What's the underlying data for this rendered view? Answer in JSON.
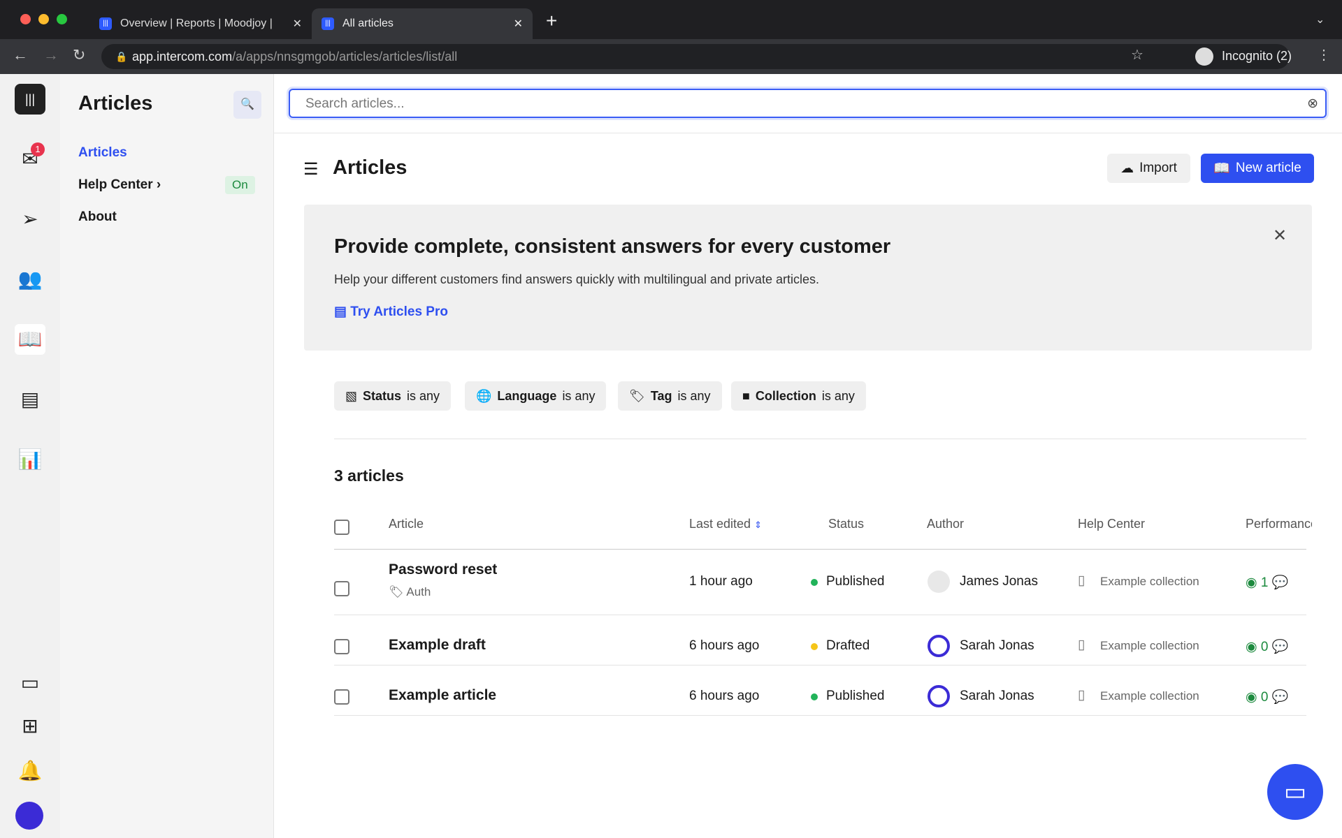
{
  "browser": {
    "tabs": [
      {
        "title": "Overview | Reports | Moodjoy |"
      },
      {
        "title": "All articles"
      }
    ],
    "url_domain": "app.intercom.com",
    "url_path": "/a/apps/nnsgmgob/articles/articles/list/all",
    "profile": "Incognito (2)"
  },
  "rail": {
    "inbox_badge": "1"
  },
  "sidebar": {
    "title": "Articles",
    "items": [
      {
        "label": "Articles"
      },
      {
        "label": "Help Center",
        "badge": "On"
      },
      {
        "label": "About"
      }
    ]
  },
  "search": {
    "placeholder": "Search articles..."
  },
  "header": {
    "title": "Articles",
    "import_label": "Import",
    "new_label": "New article"
  },
  "banner": {
    "title": "Provide complete, consistent answers for every customer",
    "text": "Help your different customers find answers quickly with multilingual and private articles.",
    "link": "Try Articles Pro"
  },
  "filters": [
    {
      "name": "Status",
      "cond": "is any"
    },
    {
      "name": "Language",
      "cond": "is any"
    },
    {
      "name": "Tag",
      "cond": "is any"
    },
    {
      "name": "Collection",
      "cond": "is any"
    }
  ],
  "count": "3 articles",
  "table": {
    "headers": [
      "Article",
      "Last edited",
      "Status",
      "Author",
      "Help Center",
      "Performance"
    ],
    "rows": [
      {
        "title": "Password reset",
        "tag": "Auth",
        "edited": "1 hour ago",
        "status": "Published",
        "author": "James Jonas",
        "collection": "Example collection",
        "views": "1"
      },
      {
        "title": "Example draft",
        "edited": "6 hours ago",
        "status": "Drafted",
        "author": "Sarah Jonas",
        "collection": "Example collection",
        "views": "0"
      },
      {
        "title": "Example article",
        "edited": "6 hours ago",
        "status": "Published",
        "author": "Sarah Jonas",
        "collection": "Example collection",
        "views": "0"
      }
    ]
  },
  "colors": {
    "accent": "#2e4ff0",
    "published": "#22b35a",
    "drafted": "#f5c518"
  }
}
